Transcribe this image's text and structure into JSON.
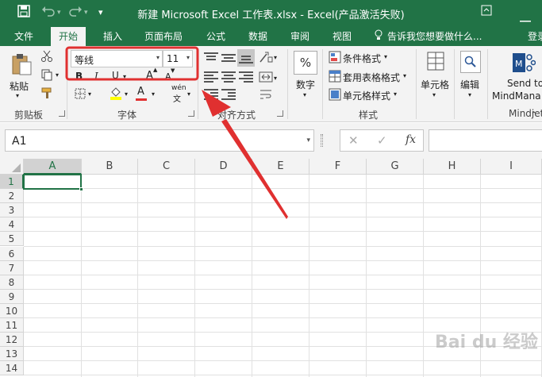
{
  "titlebar": {
    "title": "新建 Microsoft Excel 工作表.xlsx - Excel(产品激活失败)"
  },
  "tabs": [
    {
      "label": "文件"
    },
    {
      "label": "开始"
    },
    {
      "label": "插入"
    },
    {
      "label": "页面布局"
    },
    {
      "label": "公式"
    },
    {
      "label": "数据"
    },
    {
      "label": "审阅"
    },
    {
      "label": "视图"
    }
  ],
  "tell_me": "告诉我您想要做什么...",
  "signin": "登录",
  "ribbon": {
    "clipboard": {
      "paste": "粘贴",
      "label": "剪贴板"
    },
    "font": {
      "name": "等线",
      "size": "11",
      "label": "字体",
      "bold": "B",
      "italic": "I",
      "underline": "U",
      "grow": "A",
      "shrink": "A",
      "font_color_letter": "A",
      "phonetic": "wén"
    },
    "alignment": {
      "label": "对齐方式"
    },
    "number": {
      "button": "数字",
      "symbol": "%"
    },
    "styles": {
      "conditional": "条件格式",
      "table": "套用表格格式",
      "cell_styles": "单元格样式",
      "label": "样式"
    },
    "cells": {
      "button": "单元格"
    },
    "editing": {
      "button": "编辑"
    },
    "addin": {
      "line1": "Send to",
      "line2": "MindMana",
      "label": "Mindjet"
    }
  },
  "formula_bar": {
    "name_box": "A1",
    "fx": "fx"
  },
  "grid": {
    "columns": [
      "A",
      "B",
      "C",
      "D",
      "E",
      "F",
      "G",
      "H",
      "I"
    ],
    "rows": [
      "1",
      "2",
      "3",
      "4",
      "5",
      "6",
      "7",
      "8",
      "9",
      "10",
      "11",
      "12",
      "13",
      "14"
    ]
  },
  "watermark": "Bai du 经验",
  "colors": {
    "accent": "#217346",
    "highlight_box": "#e03030",
    "arrow": "#e03030"
  }
}
